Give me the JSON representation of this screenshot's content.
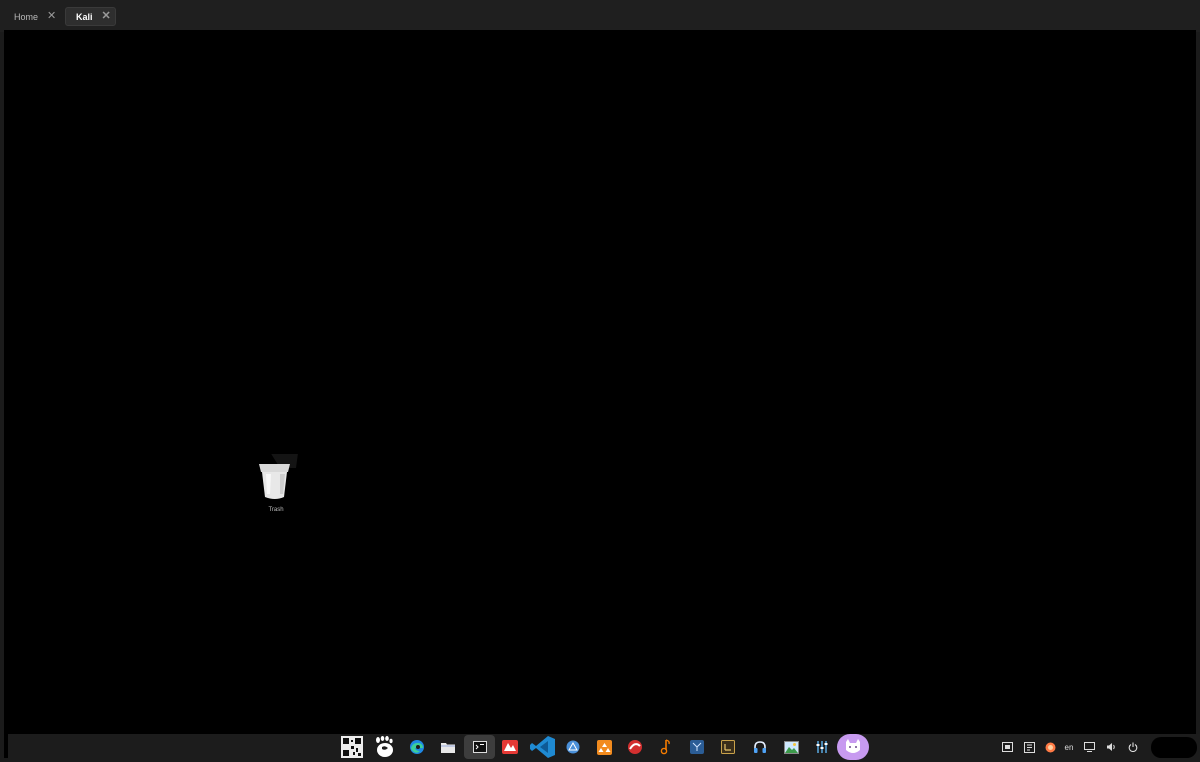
{
  "tabs": [
    {
      "label": "Home",
      "close": "✕"
    },
    {
      "label": "Kali",
      "close": "✕"
    }
  ],
  "desktop": {
    "trash_label": "Trash"
  },
  "taskbar": {
    "apps": [
      {
        "name": "qr-code-app"
      },
      {
        "name": "gnome-app"
      },
      {
        "name": "edge-browser"
      },
      {
        "name": "file-manager"
      },
      {
        "name": "terminal"
      },
      {
        "name": "red-app"
      },
      {
        "name": "vscode"
      },
      {
        "name": "blue-circle-app"
      },
      {
        "name": "orange-app"
      },
      {
        "name": "red-circle-app"
      },
      {
        "name": "orange-music-app"
      },
      {
        "name": "blue-square-app"
      },
      {
        "name": "dark-square-app"
      },
      {
        "name": "headphones-app"
      },
      {
        "name": "image-app"
      },
      {
        "name": "tools-app"
      },
      {
        "name": "cat-app"
      }
    ],
    "tray": {
      "language": "en"
    }
  },
  "colors": {
    "desktop_bg": "#000000",
    "taskbar_bg": "#1c1c1c",
    "tab_bg": "#1f1f1f",
    "cat_app": "#c79af0",
    "vscode_blue": "#1f8ad2"
  }
}
